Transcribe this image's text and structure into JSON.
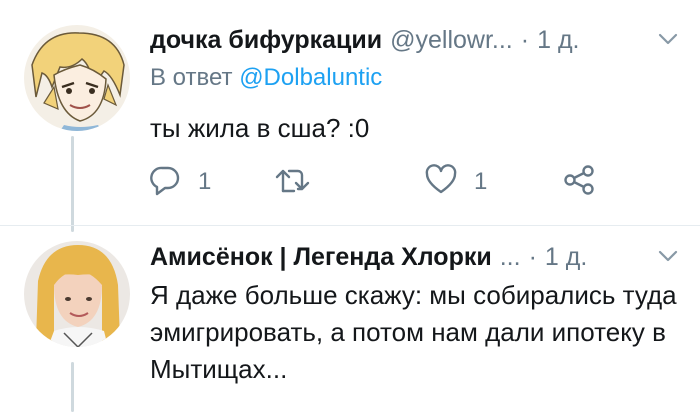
{
  "tweets": [
    {
      "author_name": "дочка бифуркации",
      "handle": "@yellowr...",
      "time": "1 д.",
      "reply_prefix": "В ответ",
      "reply_mention": "@Dolbaluntic",
      "text": "ты жила в сша? :0",
      "reply_count": "1",
      "like_count": "1",
      "retweet_count": ""
    },
    {
      "author_name": "Амисёнок | Легенда Хлорки",
      "handle": "...",
      "time": "1 д.",
      "text": "Я даже больше скажу: мы собирались туда эмигрировать, а потом нам дали ипотеку в Мытищах..."
    }
  ],
  "separator_dot": "·",
  "icons": {
    "reply": "reply-icon",
    "retweet": "retweet-icon",
    "like": "heart-icon",
    "share": "share-icon",
    "menu": "chevron-down-icon"
  },
  "colors": {
    "text": "#14171a",
    "secondary": "#657786",
    "link": "#1da1f2",
    "thread_line": "#cfd9de"
  }
}
